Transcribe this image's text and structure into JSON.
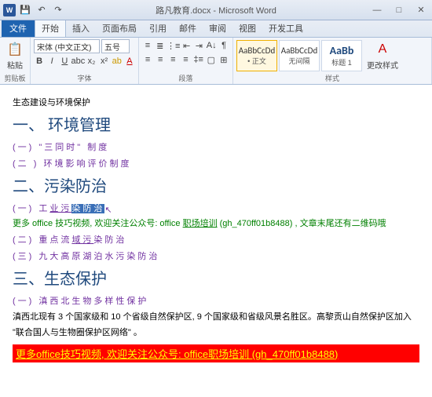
{
  "window": {
    "title": "路凡教育.docx - Microsoft Word"
  },
  "tabs": {
    "file": "文件",
    "home": "开始",
    "insert": "插入",
    "layout": "页面布局",
    "ref": "引用",
    "mail": "邮件",
    "review": "审阅",
    "view": "视图",
    "dev": "开发工具"
  },
  "ribbon": {
    "paste": "粘贴",
    "clipboard_label": "剪贴板",
    "font_name": "宋体 (中文正文)",
    "font_size": "五号",
    "font_label": "字体",
    "para_label": "段落",
    "style1_sample": "AaBbCcDd",
    "style1_name": "• 正文",
    "style2_sample": "AaBbCcDd",
    "style2_name": "无间隔",
    "style3_sample": "AaBb",
    "style3_name": "标题 1",
    "styles_label": "样式",
    "change_styles": "更改样式"
  },
  "doc": {
    "line1": "生态建设与环境保护",
    "h1": "一、 环境管理",
    "s1a": "(一) \"三同时\" 制度",
    "s1b": "(二 ) 环境影响评价制度",
    "h2": "二、污染防治",
    "s2a_prefix": "(一) 工",
    "s2a_mid": "业污",
    "s2a_hl": "染防治",
    "promo1": "更多 office 技巧视频, 欢迎关注公众号: office ",
    "promo1_link": "职场培训",
    "promo1_tail": " (gh_470ff01b8488) , 文章末尾还有二维码哦",
    "s2b": "(二)  重点流",
    "s2b_u": "域污",
    "s2b_tail": "染防治",
    "s2c": "(三)  九大高原湖",
    "s2c_tail": "泊水污染防治",
    "h3": "三、生态保护",
    "s3a": "(一)  滇西北生",
    "s3a_tail": "物多样性保护",
    "para1": "滇西北现有 3 个国家级和 10 个省级自然保护区, 9 个国家级和省级风景名胜区。高黎贡山自然保护区加入 \"联合国人与生物圈保护区网络\" 。",
    "footer_promo": "更多office技巧视频, 欢迎关注公众号: office职场培训 (gh_470ff01b8488)"
  }
}
